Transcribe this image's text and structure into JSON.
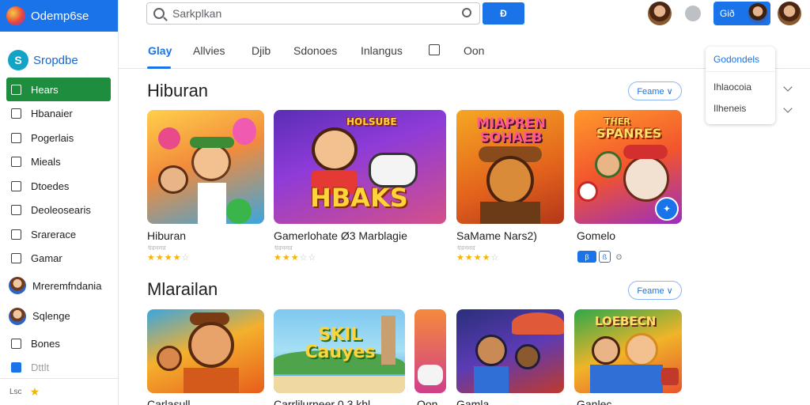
{
  "brand": {
    "name": "Odemp6se"
  },
  "app": {
    "name": "Sropdbe",
    "logo_glyph": "S"
  },
  "sidebar": {
    "items": [
      {
        "label": "Hears",
        "kind": "icon",
        "active": true
      },
      {
        "label": "Hbanaier",
        "kind": "icon"
      },
      {
        "label": "Pogerlais",
        "kind": "icon"
      },
      {
        "label": "Mieals",
        "kind": "icon"
      },
      {
        "label": "Dtoedes",
        "kind": "icon"
      },
      {
        "label": "Deoleosearis",
        "kind": "icon"
      },
      {
        "label": "Srarerace",
        "kind": "icon"
      },
      {
        "label": "Gamar",
        "kind": "icon"
      },
      {
        "label": "Mreremfndania",
        "kind": "avatar"
      },
      {
        "label": "Sqlenge",
        "kind": "avatar"
      },
      {
        "label": "Bones",
        "kind": "icon"
      },
      {
        "label": "Dttlt",
        "kind": "icon",
        "dim": true
      }
    ],
    "footer_label": "Lsc"
  },
  "search": {
    "value": "Sarkplkan",
    "button_label": "Ð"
  },
  "account": {
    "label": "Gið"
  },
  "tabs": [
    {
      "label": "Glay",
      "active": true
    },
    {
      "label": "Allvies"
    },
    {
      "label": "Djib"
    },
    {
      "label": "Sdonoes"
    },
    {
      "label": "Inlangus"
    },
    {
      "label": "Oon"
    }
  ],
  "dropdown": {
    "header": "Godondels",
    "items": [
      "Ihlaocoia",
      "Ilheneis"
    ]
  },
  "sections": [
    {
      "title": "Hiburan",
      "filter_label": "Feame ∨",
      "cards": [
        {
          "title": "Hiburan",
          "subtitle": "ধরননর",
          "rating": 4,
          "art_text": ""
        },
        {
          "title": "Gamerlohate Ø3 Marblagie",
          "subtitle": "ধরননর",
          "rating": 3,
          "art_text": "HBAKS",
          "art_text_top": "HOLSUBE"
        },
        {
          "title": "SaMame Nars2)",
          "subtitle": "ধরননর",
          "rating": 4,
          "art_text": "MIAPREN SOHAEB"
        },
        {
          "title": "Gomelo",
          "subtitle": "",
          "rating": 0,
          "art_text": "SPANRES",
          "art_text_top": "THER",
          "badges": [
            "β",
            "ß",
            "ʘ"
          ]
        }
      ]
    },
    {
      "title": "Mlarailan",
      "filter_label": "Feame ∨",
      "cards": [
        {
          "title": "Carlasull",
          "art_text": ""
        },
        {
          "title": "Carrlilurneer 0.3 khl",
          "art_text": "SKIL Cauyes"
        },
        {
          "title": "Oon",
          "art_text": ""
        },
        {
          "title": "Gamla",
          "art_text": ""
        },
        {
          "title": "Ganlec",
          "art_text": "LOEBECN"
        }
      ]
    }
  ],
  "colors": {
    "accent": "#1a73e8",
    "active_sidebar": "#1e8e3e",
    "star": "#f6b400"
  }
}
